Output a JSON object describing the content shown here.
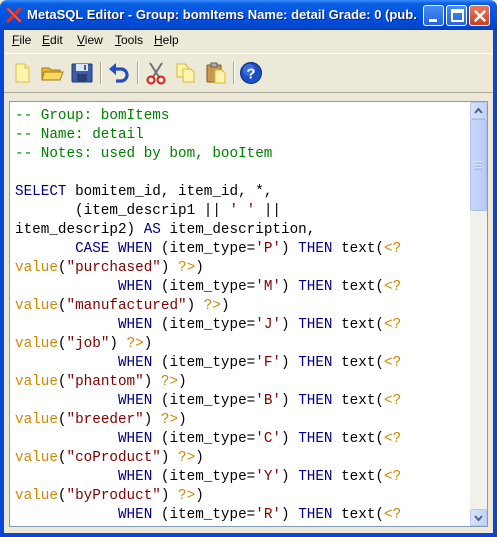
{
  "window": {
    "title": "MetaSQL Editor - Group: bomItems Name: detail Grade: 0 (pub...",
    "buttons": [
      "minimize",
      "maximize",
      "close"
    ]
  },
  "menu": {
    "file": "File",
    "edit": "Edit",
    "view": "View",
    "tools": "Tools",
    "help": "Help"
  },
  "toolbar": {
    "icons": [
      "new-document-icon",
      "open-folder-icon",
      "save-disk-icon",
      "undo-icon",
      "cut-scissors-icon",
      "copy-icon",
      "paste-icon",
      "help-icon"
    ]
  },
  "colors": {
    "comment": "#008000",
    "keyword": "#000080",
    "string": "#800000",
    "template_tag": "#D08800"
  },
  "editor": {
    "lines": [
      [
        {
          "t": "c",
          "v": "-- Group: bomItems"
        }
      ],
      [
        {
          "t": "c",
          "v": "-- Name: detail"
        }
      ],
      [
        {
          "t": "c",
          "v": "-- Notes: used by bom, booItem"
        }
      ],
      [
        {
          "t": "p",
          "v": ""
        }
      ],
      [
        {
          "t": "k",
          "v": "SELECT"
        },
        {
          "t": "p",
          "v": " bomitem_id, item_id, *,"
        }
      ],
      [
        {
          "t": "p",
          "v": "       (item_descrip1 || "
        },
        {
          "t": "s",
          "v": "' '"
        },
        {
          "t": "p",
          "v": " ||"
        }
      ],
      [
        {
          "t": "p",
          "v": "item_descrip2) "
        },
        {
          "t": "k",
          "v": "AS"
        },
        {
          "t": "p",
          "v": " item_description,"
        }
      ],
      [
        {
          "t": "p",
          "v": "       "
        },
        {
          "t": "k",
          "v": "CASE WHEN"
        },
        {
          "t": "p",
          "v": " (item_type="
        },
        {
          "t": "s",
          "v": "'P'"
        },
        {
          "t": "p",
          "v": ") "
        },
        {
          "t": "k",
          "v": "THEN"
        },
        {
          "t": "p",
          "v": " text("
        },
        {
          "t": "g",
          "v": "<?"
        }
      ],
      [
        {
          "t": "g",
          "v": "value"
        },
        {
          "t": "p",
          "v": "("
        },
        {
          "t": "s",
          "v": "\"purchased\""
        },
        {
          "t": "p",
          "v": ") "
        },
        {
          "t": "g",
          "v": "?>"
        },
        {
          "t": "p",
          "v": ")"
        }
      ],
      [
        {
          "t": "p",
          "v": "            "
        },
        {
          "t": "k",
          "v": "WHEN"
        },
        {
          "t": "p",
          "v": " (item_type="
        },
        {
          "t": "s",
          "v": "'M'"
        },
        {
          "t": "p",
          "v": ") "
        },
        {
          "t": "k",
          "v": "THEN"
        },
        {
          "t": "p",
          "v": " text("
        },
        {
          "t": "g",
          "v": "<?"
        }
      ],
      [
        {
          "t": "g",
          "v": "value"
        },
        {
          "t": "p",
          "v": "("
        },
        {
          "t": "s",
          "v": "\"manufactured\""
        },
        {
          "t": "p",
          "v": ") "
        },
        {
          "t": "g",
          "v": "?>"
        },
        {
          "t": "p",
          "v": ")"
        }
      ],
      [
        {
          "t": "p",
          "v": "            "
        },
        {
          "t": "k",
          "v": "WHEN"
        },
        {
          "t": "p",
          "v": " (item_type="
        },
        {
          "t": "s",
          "v": "'J'"
        },
        {
          "t": "p",
          "v": ") "
        },
        {
          "t": "k",
          "v": "THEN"
        },
        {
          "t": "p",
          "v": " text("
        },
        {
          "t": "g",
          "v": "<?"
        }
      ],
      [
        {
          "t": "g",
          "v": "value"
        },
        {
          "t": "p",
          "v": "("
        },
        {
          "t": "s",
          "v": "\"job\""
        },
        {
          "t": "p",
          "v": ") "
        },
        {
          "t": "g",
          "v": "?>"
        },
        {
          "t": "p",
          "v": ")"
        }
      ],
      [
        {
          "t": "p",
          "v": "            "
        },
        {
          "t": "k",
          "v": "WHEN"
        },
        {
          "t": "p",
          "v": " (item_type="
        },
        {
          "t": "s",
          "v": "'F'"
        },
        {
          "t": "p",
          "v": ") "
        },
        {
          "t": "k",
          "v": "THEN"
        },
        {
          "t": "p",
          "v": " text("
        },
        {
          "t": "g",
          "v": "<?"
        }
      ],
      [
        {
          "t": "g",
          "v": "value"
        },
        {
          "t": "p",
          "v": "("
        },
        {
          "t": "s",
          "v": "\"phantom\""
        },
        {
          "t": "p",
          "v": ") "
        },
        {
          "t": "g",
          "v": "?>"
        },
        {
          "t": "p",
          "v": ")"
        }
      ],
      [
        {
          "t": "p",
          "v": "            "
        },
        {
          "t": "k",
          "v": "WHEN"
        },
        {
          "t": "p",
          "v": " (item_type="
        },
        {
          "t": "s",
          "v": "'B'"
        },
        {
          "t": "p",
          "v": ") "
        },
        {
          "t": "k",
          "v": "THEN"
        },
        {
          "t": "p",
          "v": " text("
        },
        {
          "t": "g",
          "v": "<?"
        }
      ],
      [
        {
          "t": "g",
          "v": "value"
        },
        {
          "t": "p",
          "v": "("
        },
        {
          "t": "s",
          "v": "\"breeder\""
        },
        {
          "t": "p",
          "v": ") "
        },
        {
          "t": "g",
          "v": "?>"
        },
        {
          "t": "p",
          "v": ")"
        }
      ],
      [
        {
          "t": "p",
          "v": "            "
        },
        {
          "t": "k",
          "v": "WHEN"
        },
        {
          "t": "p",
          "v": " (item_type="
        },
        {
          "t": "s",
          "v": "'C'"
        },
        {
          "t": "p",
          "v": ") "
        },
        {
          "t": "k",
          "v": "THEN"
        },
        {
          "t": "p",
          "v": " text("
        },
        {
          "t": "g",
          "v": "<?"
        }
      ],
      [
        {
          "t": "g",
          "v": "value"
        },
        {
          "t": "p",
          "v": "("
        },
        {
          "t": "s",
          "v": "\"coProduct\""
        },
        {
          "t": "p",
          "v": ") "
        },
        {
          "t": "g",
          "v": "?>"
        },
        {
          "t": "p",
          "v": ")"
        }
      ],
      [
        {
          "t": "p",
          "v": "            "
        },
        {
          "t": "k",
          "v": "WHEN"
        },
        {
          "t": "p",
          "v": " (item_type="
        },
        {
          "t": "s",
          "v": "'Y'"
        },
        {
          "t": "p",
          "v": ") "
        },
        {
          "t": "k",
          "v": "THEN"
        },
        {
          "t": "p",
          "v": " text("
        },
        {
          "t": "g",
          "v": "<?"
        }
      ],
      [
        {
          "t": "g",
          "v": "value"
        },
        {
          "t": "p",
          "v": "("
        },
        {
          "t": "s",
          "v": "\"byProduct\""
        },
        {
          "t": "p",
          "v": ") "
        },
        {
          "t": "g",
          "v": "?>"
        },
        {
          "t": "p",
          "v": ")"
        }
      ],
      [
        {
          "t": "p",
          "v": "            "
        },
        {
          "t": "k",
          "v": "WHEN"
        },
        {
          "t": "p",
          "v": " (item_type="
        },
        {
          "t": "s",
          "v": "'R'"
        },
        {
          "t": "p",
          "v": ") "
        },
        {
          "t": "k",
          "v": "THEN"
        },
        {
          "t": "p",
          "v": " text("
        },
        {
          "t": "g",
          "v": "<?"
        }
      ]
    ]
  }
}
